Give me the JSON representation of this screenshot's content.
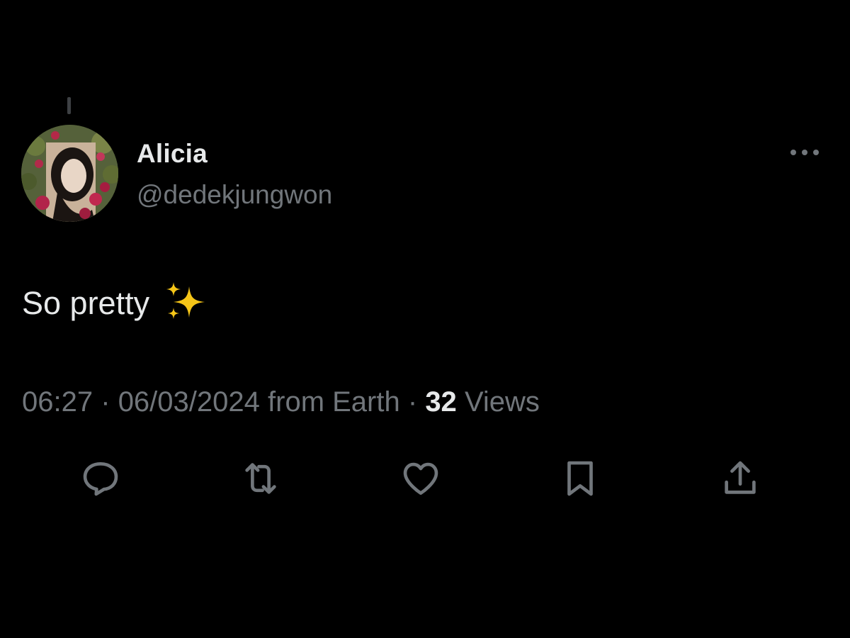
{
  "tweet": {
    "author": {
      "display_name": "Alicia",
      "handle": "@dedekjungwon",
      "avatar_icon": "profile-photo"
    },
    "text": "So pretty",
    "emoji": "sparkles",
    "time": "06:27",
    "separator": "·",
    "date": "06/03/2024",
    "source": "from Earth",
    "views_count": "32",
    "views_label": "Views"
  },
  "actions": [
    {
      "name": "reply",
      "icon": "reply-icon"
    },
    {
      "name": "retweet",
      "icon": "retweet-icon"
    },
    {
      "name": "like",
      "icon": "heart-icon"
    },
    {
      "name": "bookmark",
      "icon": "bookmark-icon"
    },
    {
      "name": "share",
      "icon": "share-icon"
    }
  ],
  "colors": {
    "background": "#000000",
    "primary_text": "#e7e9ea",
    "secondary_text": "#71767b",
    "sparkle": "#f5c518"
  }
}
